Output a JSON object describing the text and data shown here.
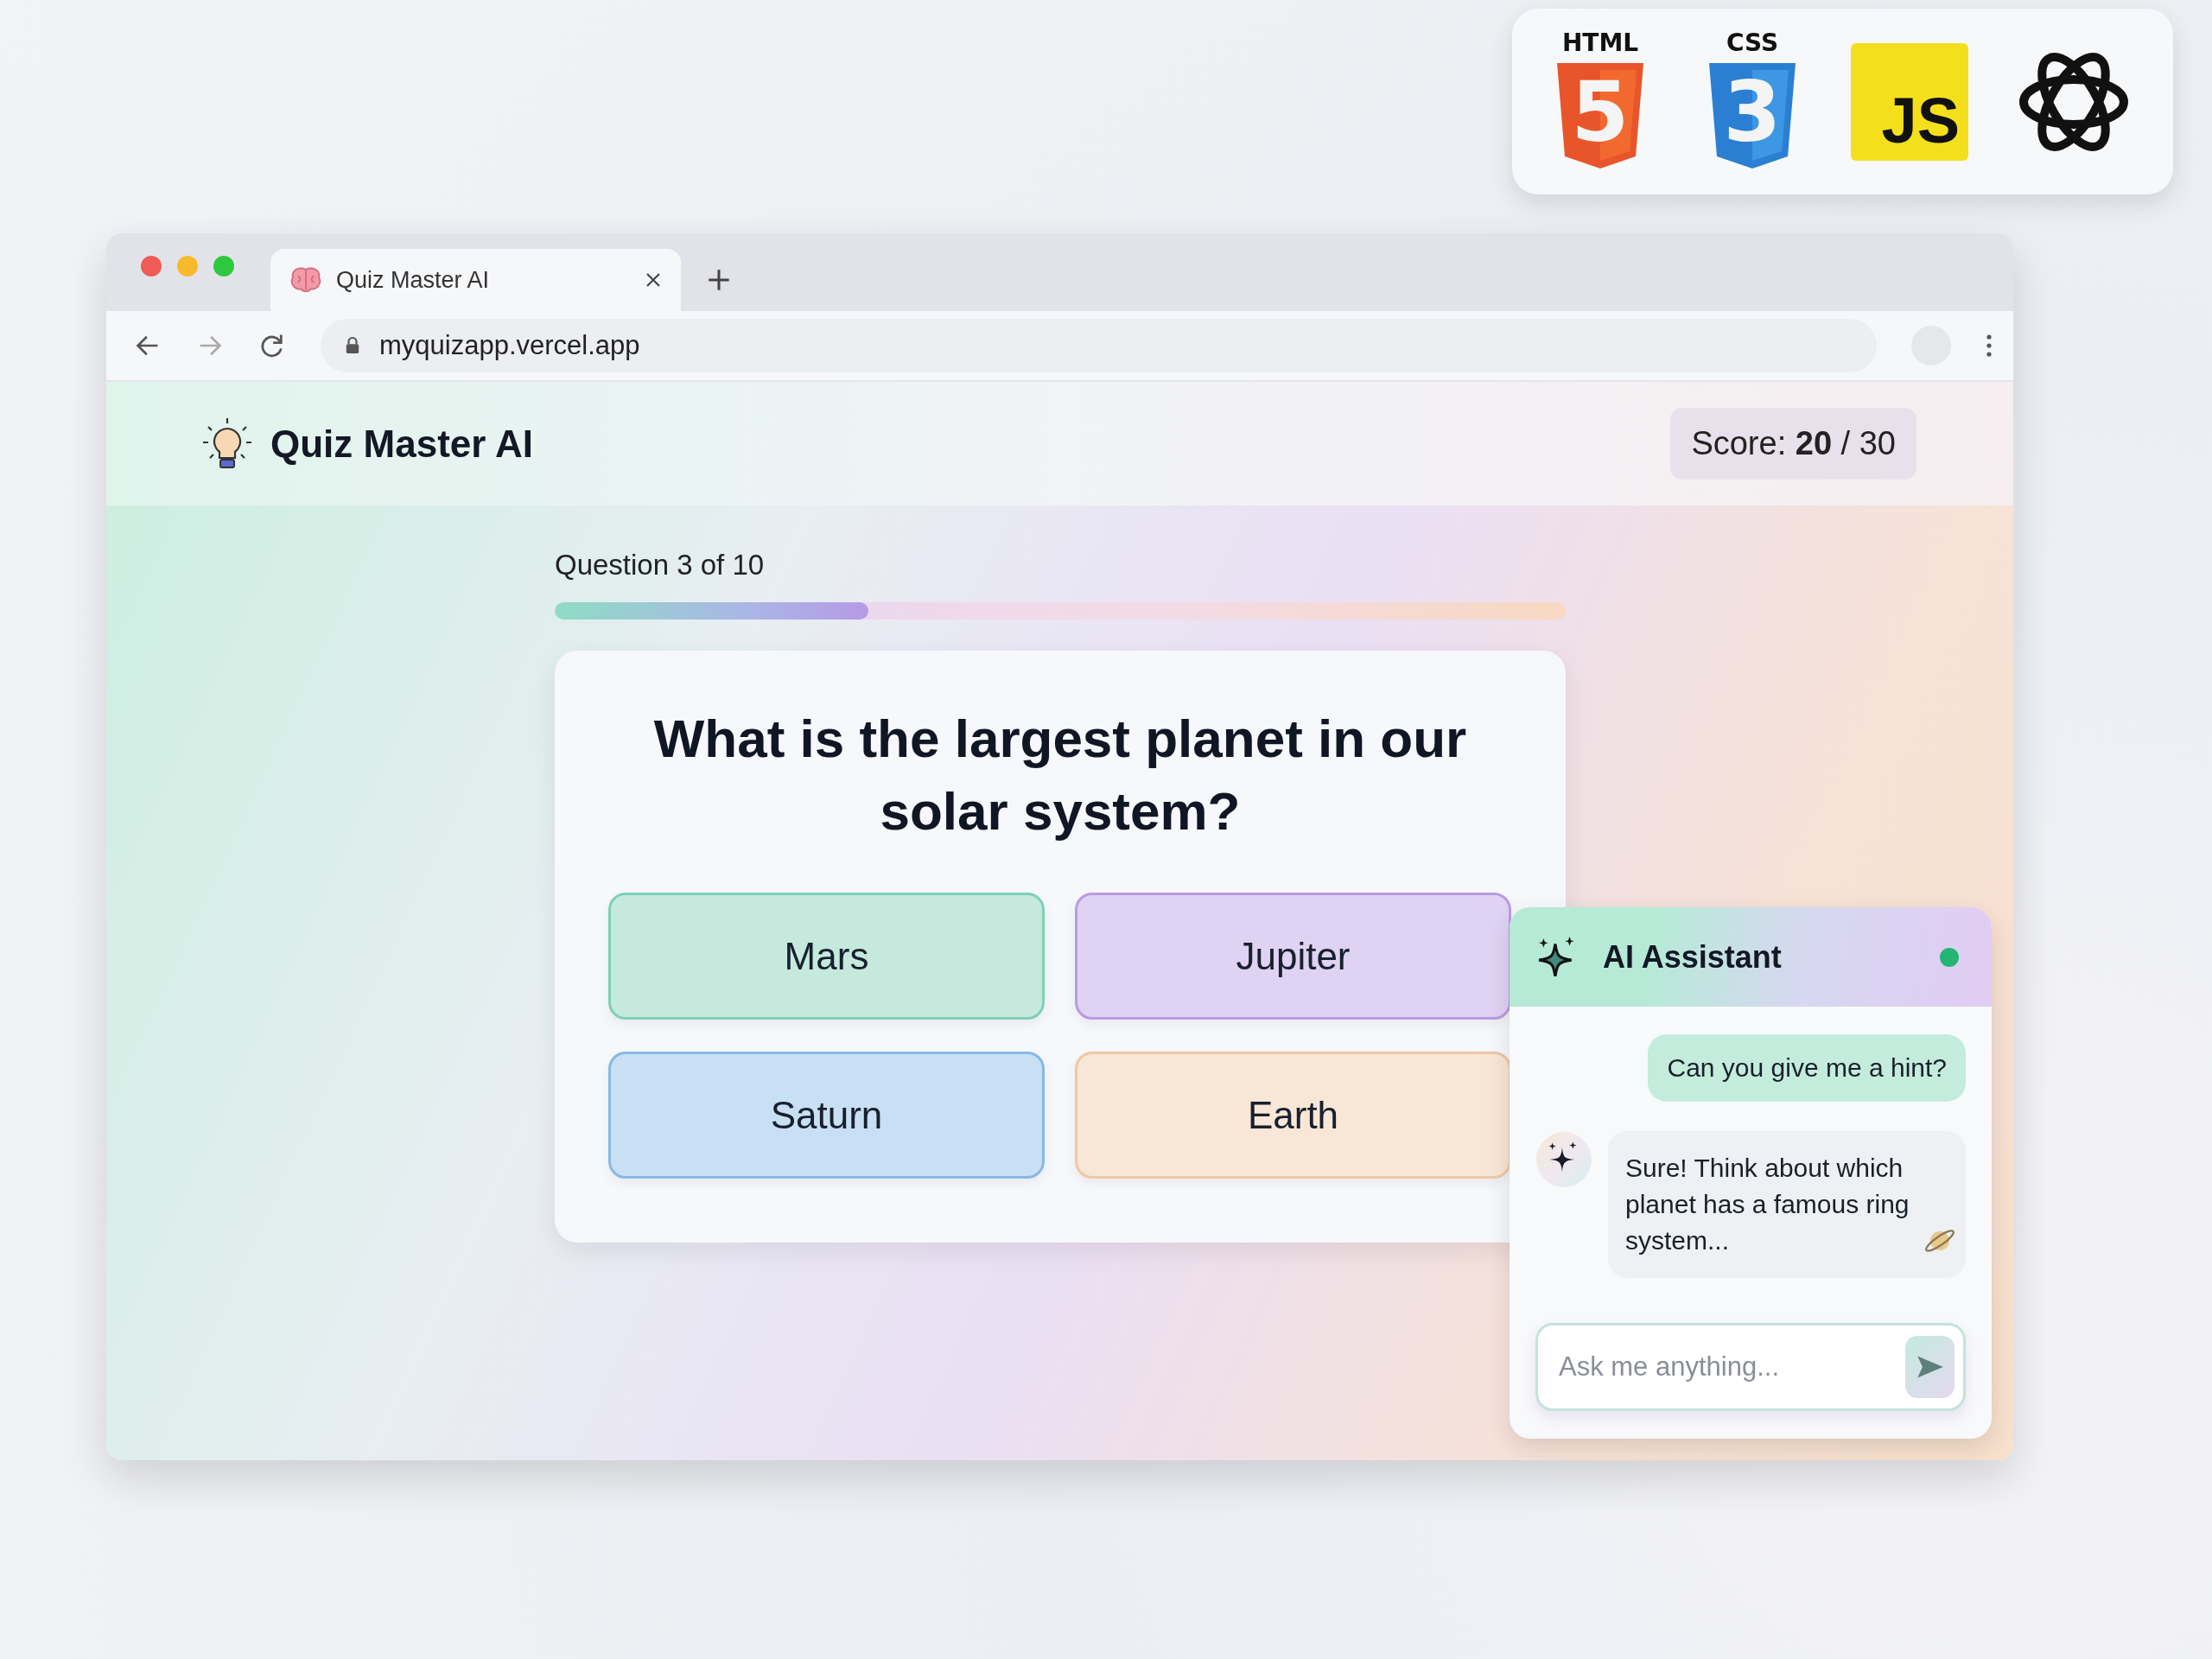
{
  "tech_logos": [
    {
      "kind": "html",
      "label": "HTML",
      "glyph": "5"
    },
    {
      "kind": "css",
      "label": "CSS",
      "glyph": "3"
    },
    {
      "kind": "js",
      "label": "JS"
    },
    {
      "kind": "knot"
    }
  ],
  "browser": {
    "tab_title": "Quiz Master AI",
    "url": "myquizapp.vercel.app"
  },
  "app": {
    "title": "Quiz Master AI",
    "score": "Score: **20** / 30"
  },
  "quiz": {
    "progress_label": "Question 3 of 10",
    "level": 0.31,
    "question": "What is the largest planet in our solar system?",
    "answers": [
      {
        "label": "Mars",
        "color": "#7fd0b4"
      },
      {
        "label": "Jupiter",
        "color": "#b99be3"
      },
      {
        "label": "Saturn",
        "color": "#86b9e6"
      },
      {
        "label": "Earth",
        "color": "#efc8a4"
      }
    ]
  },
  "assistant": {
    "title": "AI Assistant",
    "online": true,
    "messages": [
      {
        "kind": "user",
        "text": "Can you give me a hint?"
      },
      {
        "kind": "bot",
        "text": "Sure! Think about which planet has a famous ring system..."
      }
    ],
    "input": {
      "placeholder": "Ask me anything..."
    }
  }
}
